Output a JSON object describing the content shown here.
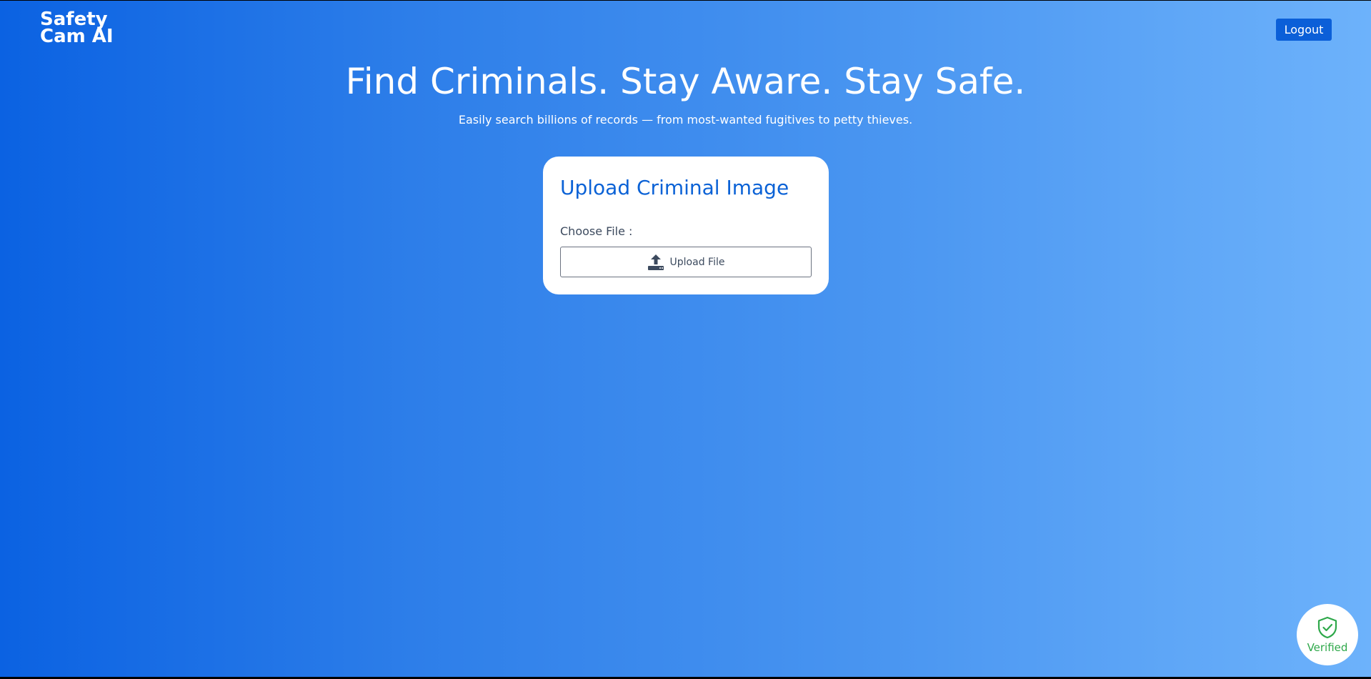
{
  "header": {
    "logo_line1": "Safety",
    "logo_line2": "Cam AI",
    "logout_label": "Logout"
  },
  "hero": {
    "title": "Find Criminals. Stay Aware. Stay Safe.",
    "subtitle": "Easily search billions of records — from most-wanted fugitives to petty thieves."
  },
  "upload_card": {
    "title": "Upload Criminal Image",
    "choose_label": "Choose File :",
    "upload_button_label": "Upload File",
    "upload_icon": "upload-icon"
  },
  "badge": {
    "label": "Verified",
    "icon": "shield-check-icon"
  },
  "colors": {
    "gradient_start": "#0b62e2",
    "gradient_end": "#6db2fb",
    "accent": "#0b62d6",
    "verified_green": "#2ea84a"
  }
}
